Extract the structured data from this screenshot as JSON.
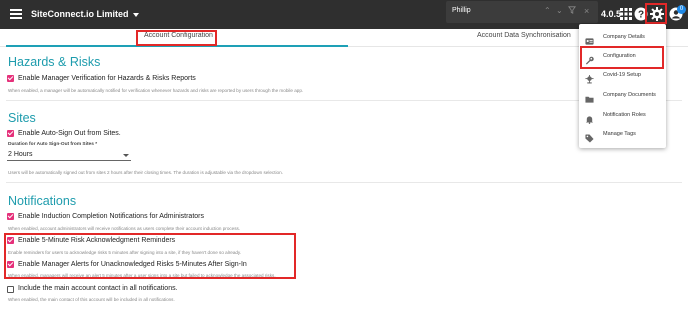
{
  "topbar": {
    "company_name": "SiteConnect.io Limited",
    "search_term": "Phillip",
    "version": "4.0.5",
    "notification_count": "0"
  },
  "tabs": [
    {
      "label": "Account Configuration",
      "active": true
    },
    {
      "label": "Account Data Synchronisation",
      "active": false
    }
  ],
  "hazards": {
    "title": "Hazards & Risks",
    "options": [
      {
        "label": "Enable Manager Verification for Hazards & Risks Reports",
        "checked": true,
        "help": "When enabled, a manager will be automatically notified for verification whenever hazards and risks are reported by users through the mobile app."
      }
    ]
  },
  "sites": {
    "title": "Sites",
    "auto_signout": {
      "label": "Enable Auto-Sign Out from Sites.",
      "checked": true
    },
    "duration_label": "Duration for Auto Sign-Out from Sites *",
    "duration_value": "2 Hours",
    "help": "Users will be automatically signed out from sites 2 hours after their closing times. The duration is adjustable via the dropdown selection."
  },
  "notifications": {
    "title": "Notifications",
    "options": [
      {
        "label": "Enable Induction Completion Notifications for Administrators",
        "checked": true,
        "help": "When enabled, account administrators will receive notifications as users complete their account induction process."
      },
      {
        "label": "Enable 5-Minute Risk Acknowledgment Reminders",
        "checked": true,
        "help": "Enable reminders for users to acknowledge risks 5 minutes after signing into a site, if they haven't done so already."
      },
      {
        "label": "Enable Manager Alerts for Unacknowledged Risks 5-Minutes After Sign-In",
        "checked": true,
        "help": "When enabled, managers will receive an alert 5 minutes after a user signs into a site but failed to acknowledge the associated risks."
      },
      {
        "label": "Include the main account contact in all notifications.",
        "checked": false,
        "help": "When enabled, the main contact of this account will be included in all notifications."
      }
    ]
  },
  "menu": {
    "items": [
      {
        "label": "Company Details",
        "icon": "id-card-icon"
      },
      {
        "label": "Configuration",
        "icon": "wrench-icon"
      },
      {
        "label": "Covid-19 Setup",
        "icon": "virus-icon"
      },
      {
        "label": "Company Documents",
        "icon": "folder-icon"
      },
      {
        "label": "Notification Roles",
        "icon": "bell-icon"
      },
      {
        "label": "Manage Tags",
        "icon": "tag-icon"
      }
    ]
  },
  "colors": {
    "accent": "#1e9cad",
    "checkbox": "#e5307a",
    "highlight": "#e22828",
    "topbar": "#2f2f2f"
  }
}
